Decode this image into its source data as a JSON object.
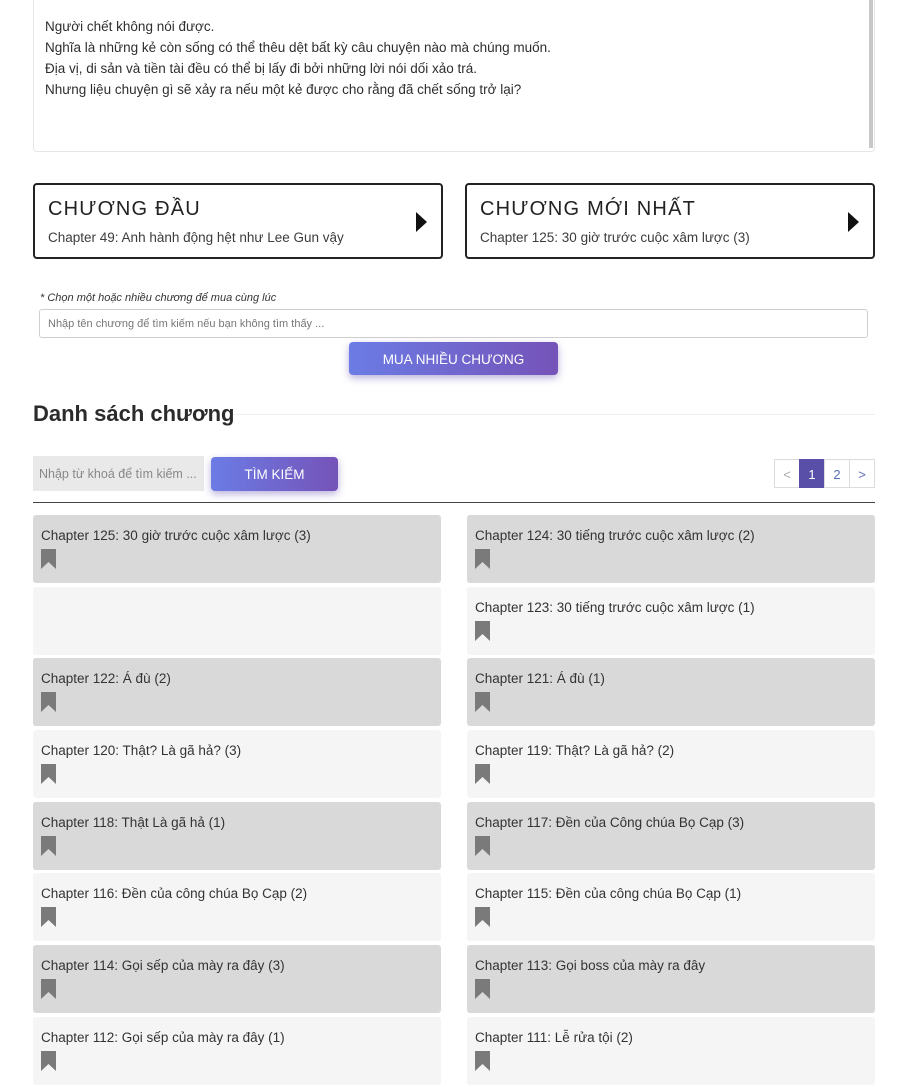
{
  "description": {
    "lines": [
      "Người chết không nói được.",
      "Nghĩa là những kẻ còn sống có thể thêu dệt bất kỳ câu chuyện nào mà chúng muốn.",
      "Địa vị, di sản và tiền tài đều có thể bị lấy đi bởi những lời nói dối xảo trá.",
      "Nhưng liệu chuyện gì sẽ xảy ra nếu một kẻ được cho rằng đã chết sống trở lại?"
    ]
  },
  "first_chapter": {
    "title": "CHƯƠNG ĐẦU",
    "subtitle": "Chapter 49: Anh hành động hệt như Lee Gun vậy",
    "icon": "play-arrow-icon"
  },
  "latest_chapter": {
    "title": "CHƯƠNG MỚI NHẤT",
    "subtitle": "Chapter 125: 30 giờ trước cuộc xâm lược (3)",
    "icon": "play-arrow-icon"
  },
  "bulk_buy": {
    "hint": "* Chọn một hoặc nhiều chương để mua cùng lúc",
    "search_placeholder": "Nhập tên chương để tìm kiếm nếu bạn không tìm thấy ...",
    "button_label": "MUA NHIỀU CHƯƠNG"
  },
  "chapter_section": {
    "title": "Danh sách chương",
    "search_placeholder": "Nhập từ khoá để tìm kiếm ...",
    "search_button": "TÌM KIẾM"
  },
  "pagination": {
    "prev": "<",
    "pages": [
      "1",
      "2"
    ],
    "current": "1",
    "next": ">"
  },
  "chapters": [
    {
      "title": "Chapter 125: 30 giờ trước cuộc xâm lược (3)",
      "style": "dark"
    },
    {
      "title": "Chapter 124: 30 tiếng trước cuộc xâm lược (2)",
      "style": "dark"
    },
    {
      "title": "",
      "style": "light"
    },
    {
      "title": "Chapter 123: 30 tiếng trước cuộc xâm lược (1)",
      "style": "light"
    },
    {
      "title": "Chapter 122: Á đù (2)",
      "style": "dark"
    },
    {
      "title": "Chapter 121: Á đù (1)",
      "style": "dark"
    },
    {
      "title": "Chapter 120: Thật? Là gã hả? (3)",
      "style": "light"
    },
    {
      "title": "Chapter 119: Thật? Là gã hả? (2)",
      "style": "light"
    },
    {
      "title": "Chapter 118: Thật Là gã hả (1)",
      "style": "dark"
    },
    {
      "title": "Chapter 117: Đền của Công chúa Bọ Cạp (3)",
      "style": "dark"
    },
    {
      "title": "Chapter 116: Đền của công chúa Bọ Cạp (2)",
      "style": "light"
    },
    {
      "title": "Chapter 115: Đền của công chúa Bọ Cạp (1)",
      "style": "light"
    },
    {
      "title": "Chapter 114: Gọi sếp của mày ra đây (3)",
      "style": "dark"
    },
    {
      "title": "Chapter 113: Gọi boss của mày ra đây",
      "style": "dark"
    },
    {
      "title": "Chapter 112: Gọi sếp của mày ra đây (1)",
      "style": "light"
    },
    {
      "title": "Chapter 111: Lễ rửa tội (2)",
      "style": "light"
    }
  ],
  "colors": {
    "accent_start": "#6b7ce5",
    "accent_end": "#7553b8",
    "row_dark": "#d9d9d9",
    "row_light": "#f5f5f5",
    "bookmark": "#7a7a7a"
  }
}
